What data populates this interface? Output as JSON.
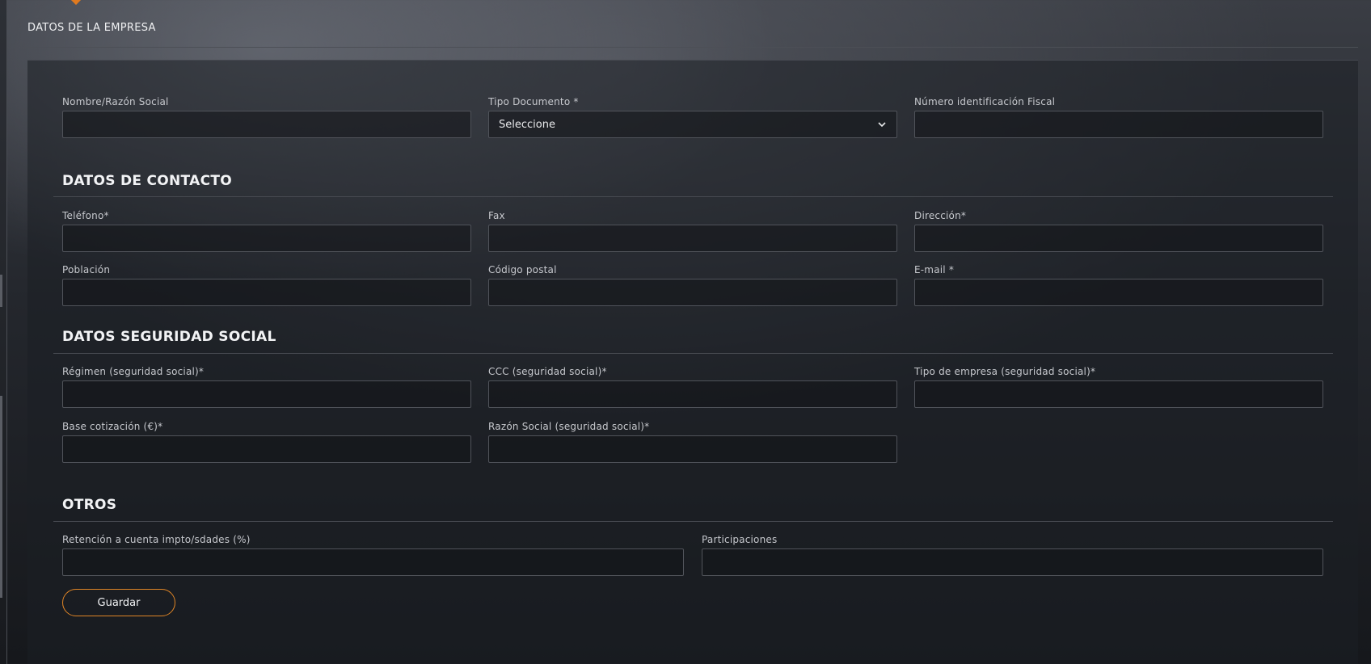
{
  "page": {
    "title": "DATOS DE LA EMPRESA"
  },
  "empresa": {
    "nombre": {
      "label": "Nombre/Razón Social",
      "value": ""
    },
    "tipo_documento": {
      "label": "Tipo Documento *",
      "selected": "Seleccione"
    },
    "nif": {
      "label": "Número identificación Fiscal",
      "value": ""
    }
  },
  "contacto": {
    "title": "DATOS DE CONTACTO",
    "telefono": {
      "label": "Teléfono*",
      "value": ""
    },
    "fax": {
      "label": "Fax",
      "value": ""
    },
    "direccion": {
      "label": "Dirección*",
      "value": ""
    },
    "poblacion": {
      "label": "Población",
      "value": ""
    },
    "codigo_postal": {
      "label": "Código postal",
      "value": ""
    },
    "email": {
      "label": "E-mail *",
      "value": ""
    }
  },
  "seguridad_social": {
    "title": "DATOS SEGURIDAD SOCIAL",
    "regimen": {
      "label": "Régimen (seguridad social)*",
      "value": ""
    },
    "ccc": {
      "label": "CCC (seguridad social)*",
      "value": ""
    },
    "tipo_empresa": {
      "label": "Tipo de empresa (seguridad social)*",
      "value": ""
    },
    "base_cotizacion": {
      "label": "Base cotización (€)*",
      "value": ""
    },
    "razon_social": {
      "label": "Razón Social (seguridad social)*",
      "value": ""
    }
  },
  "otros": {
    "title": "OTROS",
    "retencion": {
      "label": "Retención a cuenta impto/sdades (%)",
      "value": ""
    },
    "participaciones": {
      "label": "Participaciones",
      "value": ""
    }
  },
  "actions": {
    "save_label": "Guardar"
  },
  "colors": {
    "accent": "#e08526",
    "border": "#50535a"
  }
}
